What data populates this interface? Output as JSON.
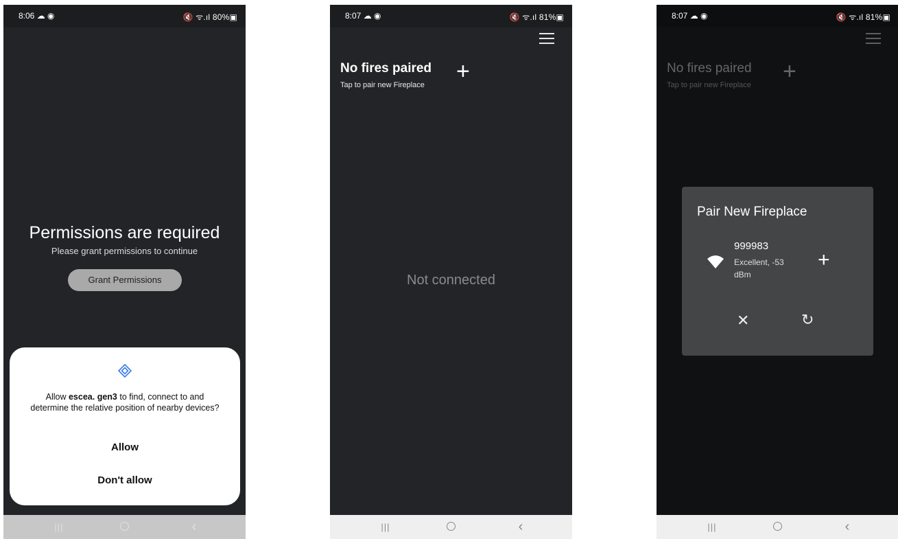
{
  "screens": [
    {
      "status": {
        "time": "8:06 ☁ ◉",
        "right": "🔇 ᯤ.ıl 80%▣"
      },
      "title": "Permissions are required",
      "subtitle": "Please grant permissions to continue",
      "grant_button": "Grant Permissions",
      "dialog": {
        "prefix": "Allow ",
        "app": "escea. gen3",
        "suffix": " to find, connect to and determine the relative position of nearby devices?",
        "allow": "Allow",
        "deny": "Don't allow"
      },
      "nav": {
        "recent": "|||",
        "back": "‹"
      }
    },
    {
      "status": {
        "time": "8:07 ☁ ◉",
        "right": "🔇 ᯤ.ıl 81%▣"
      },
      "title": "No fires paired",
      "subtitle": "Tap to pair new Fireplace",
      "plus": "+",
      "message": "Not connected",
      "nav": {
        "recent": "|||",
        "back": "‹"
      }
    },
    {
      "status": {
        "time": "8:07 ☁ ◉",
        "right": "🔇 ᯤ.ıl 81%▣"
      },
      "title": "No fires paired",
      "subtitle": "Tap to pair new Fireplace",
      "plus": "+",
      "modal": {
        "title": "Pair New Fireplace",
        "device_name": "999983",
        "device_signal": "Excellent, -53 dBm",
        "add": "+",
        "close": "✕",
        "refresh": "↻"
      },
      "nav": {
        "recent": "|||",
        "back": "‹"
      }
    }
  ],
  "colors": {
    "accent": "#3b7be8",
    "dark_bg": "#232427",
    "dialog_bg": "#ffffff",
    "modal_bg": "#444547"
  }
}
